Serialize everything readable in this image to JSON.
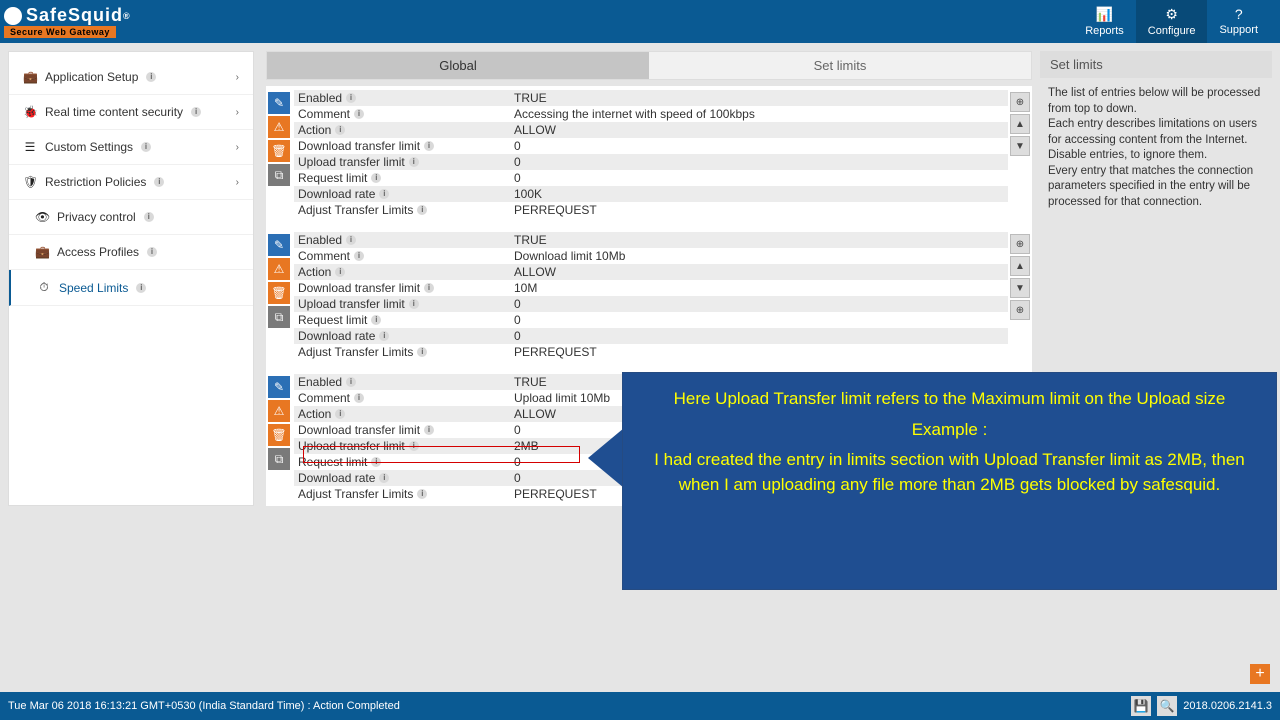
{
  "header": {
    "logo": "SafeSquid",
    "logo_reg": "®",
    "tagline": "Secure Web Gateway",
    "nav": [
      {
        "icon": "📊",
        "label": "Reports"
      },
      {
        "icon": "⚙",
        "label": "Configure"
      },
      {
        "icon": "?",
        "label": "Support"
      }
    ]
  },
  "sidebar": [
    {
      "icon": "💼",
      "label": "Application Setup",
      "expandable": true
    },
    {
      "icon": "🐞",
      "label": "Real time content security",
      "expandable": true
    },
    {
      "icon": "☰",
      "label": "Custom Settings",
      "expandable": true
    },
    {
      "icon": "🛡",
      "label": "Restriction Policies",
      "expandable": true
    },
    {
      "icon": "👁",
      "label": "Privacy control",
      "sub": true
    },
    {
      "icon": "💼",
      "label": "Access Profiles",
      "sub": true
    },
    {
      "icon": "⏱",
      "label": "Speed Limits",
      "sub": true,
      "selected": true
    }
  ],
  "tabs": [
    {
      "label": "Global",
      "active": true
    },
    {
      "label": "Set limits",
      "active": false
    }
  ],
  "fields": [
    "Enabled",
    "Comment",
    "Action",
    "Download transfer limit",
    "Upload transfer limit",
    "Request limit",
    "Download rate",
    "Adjust Transfer Limits"
  ],
  "entries": [
    {
      "side": [
        "⊕",
        "▲",
        "▼"
      ],
      "values": [
        "TRUE",
        "Accessing the internet with speed of 100kbps",
        "ALLOW",
        "0",
        "0",
        "0",
        "100K",
        "PERREQUEST"
      ]
    },
    {
      "side": [
        "⊕",
        "▲",
        "▼",
        "⊕"
      ],
      "values": [
        "TRUE",
        "Download limit 10Mb",
        "ALLOW",
        "10M",
        "0",
        "0",
        "0",
        "PERREQUEST"
      ]
    },
    {
      "side": [],
      "values": [
        "TRUE",
        "Upload limit 10Mb",
        "ALLOW",
        "0",
        "2MB",
        "0",
        "0",
        "PERREQUEST"
      ]
    }
  ],
  "right": {
    "title": "Set limits",
    "body": "The list of entries below will be processed from top to down.\nEach entry describes limitations on users for accessing content from the Internet.\nDisable entries, to ignore them.\nEvery entry that matches the connection parameters specified in the entry will be processed for that connection."
  },
  "callout": {
    "l1": "Here Upload Transfer limit refers to the Maximum limit on the Upload size",
    "l2": "Example :",
    "l3": "I had created the entry in limits section with Upload Transfer limit as 2MB, then when I am uploading  any file more than 2MB gets blocked by safesquid."
  },
  "footer": {
    "status": "Tue Mar 06 2018 16:13:21 GMT+0530 (India Standard Time) : Action Completed",
    "version": "2018.0206.2141.3"
  },
  "icons": {
    "save": "💾",
    "search": "🔍",
    "add": "+"
  }
}
